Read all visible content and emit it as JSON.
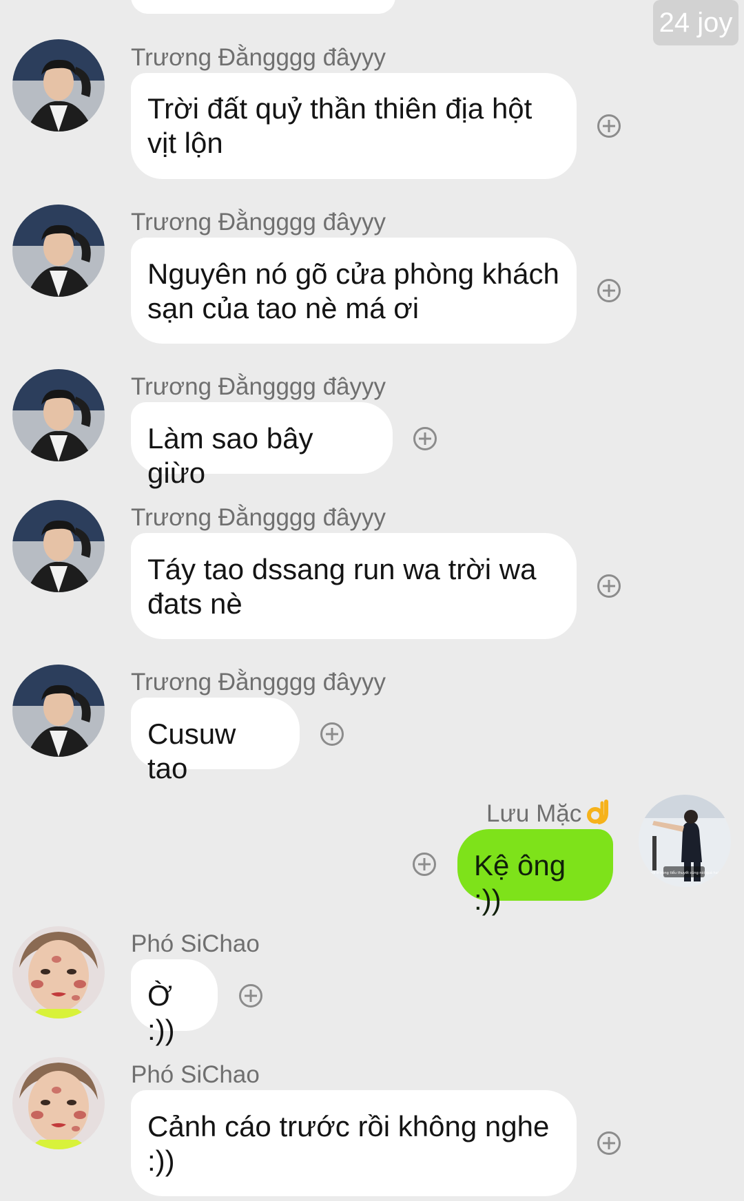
{
  "badge": {
    "text": "24 joy"
  },
  "messages": [
    {
      "sender": "Trương Đằngggg đâyyy",
      "text": "Trời đất quỷ thần thiên địa hột vịt lộn"
    },
    {
      "sender": "Trương Đằngggg đâyyy",
      "text": "Nguyên nó gõ cửa phòng khách sạn của tao nè má ơi"
    },
    {
      "sender": "Trương Đằngggg đâyyy",
      "text": "Làm sao bây giừo"
    },
    {
      "sender": "Trương Đằngggg đâyyy",
      "text": "Táy tao dssang run wa trời wa đats nè"
    },
    {
      "sender": "Trương Đằngggg đâyyy",
      "text": "Cusuw tao"
    },
    {
      "sender": "Lưu Mặc",
      "text": "Kệ ông :))",
      "sender_emoji": "ok-hand-icon"
    },
    {
      "sender": "Phó SiChao",
      "text": "Ờ :))"
    },
    {
      "sender": "Phó SiChao",
      "text": "Cảnh cáo trước rồi không nghe :))"
    }
  ],
  "avatar_tiny_caption": "Nếu mà ở trong tiểu thuyết cũng nói quá hai đứa",
  "colors": {
    "background": "#ebebeb",
    "incoming_bubble": "#ffffff",
    "outgoing_bubble": "#7ee21a",
    "sender_text": "#6f6f6f"
  }
}
